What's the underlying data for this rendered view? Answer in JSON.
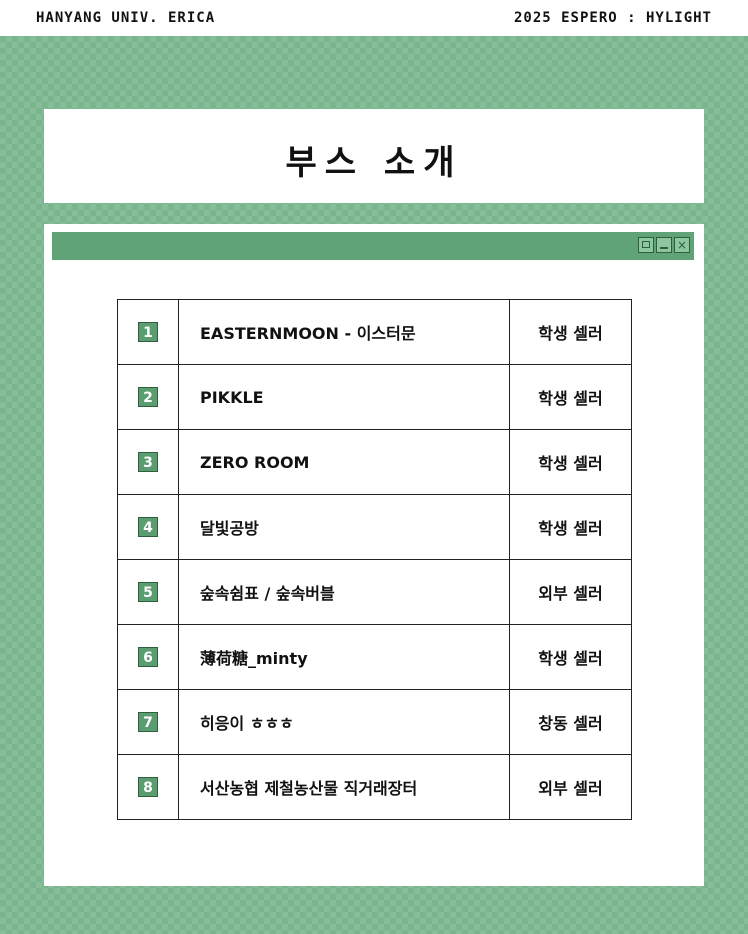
{
  "header": {
    "left_text": "HANYANG UNIV. ERICA",
    "right_text": "2025 ESPERO : HYLIGHT"
  },
  "title": "부스 소개",
  "window": {
    "buttons": [
      "maximize-icon",
      "minimize-icon",
      "close-icon"
    ],
    "close_glyph": "×"
  },
  "booths": [
    {
      "num": "1",
      "name": "EASTERNMOON - 이스터문",
      "type": "학생 셀러"
    },
    {
      "num": "2",
      "name": "PIKKLE",
      "type": "학생 셀러"
    },
    {
      "num": "3",
      "name": "ZERO ROOM",
      "type": "학생 셀러"
    },
    {
      "num": "4",
      "name": "달빛공방",
      "type": "학생 셀러"
    },
    {
      "num": "5",
      "name": "숲속쉼표 / 숲속버블",
      "type": "외부 셀러"
    },
    {
      "num": "6",
      "name": "薄荷糖_minty",
      "type": "학생 셀러"
    },
    {
      "num": "7",
      "name": "히응이 ㅎㅎㅎ",
      "type": "창동 셀러"
    },
    {
      "num": "8",
      "name": "서산농협 제철농산물 직거래장터",
      "type": "외부 셀러"
    }
  ],
  "colors": {
    "background": "#79b68e",
    "window_bar": "#5fa377",
    "badge": "#5b9d71"
  }
}
